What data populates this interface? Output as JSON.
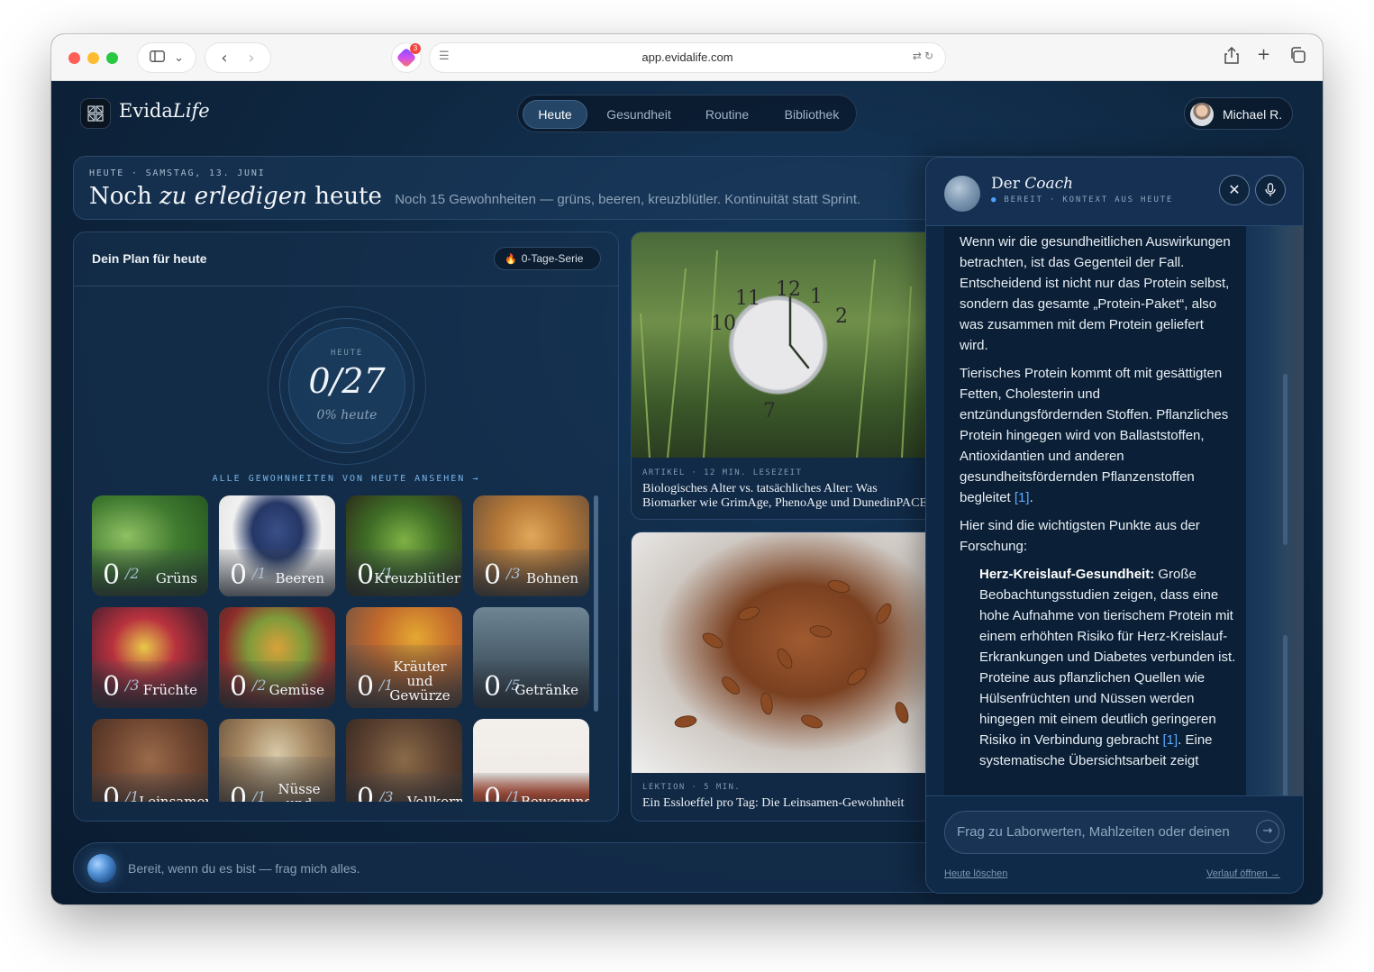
{
  "browser": {
    "url": "app.evidalife.com",
    "extension_badge": "3"
  },
  "app": {
    "brand_main": "Evida",
    "brand_italic": "Life",
    "nav": [
      {
        "label": "Heute",
        "active": true
      },
      {
        "label": "Gesundheit",
        "active": false
      },
      {
        "label": "Routine",
        "active": false
      },
      {
        "label": "Bibliothek",
        "active": false
      }
    ],
    "user_name": "Michael R."
  },
  "header": {
    "eyebrow": "HEUTE · SAMSTAG, 13. JUNI",
    "title_start": "Noch ",
    "title_italic": "zu erledigen",
    "title_end": " heute",
    "subtitle": "Noch 15 Gewohnheiten — grüns, beeren, kreuzblütler. Kontinuität statt Sprint."
  },
  "plan": {
    "title": "Dein Plan für heute",
    "streak": "0-Tage-Serie",
    "ring_label": "HEUTE",
    "ring_value": "0/27",
    "ring_pct": "0% heute",
    "all_habits_link": "ALLE GEWOHNHEITEN VON HEUTE ANSEHEN →",
    "habits": [
      {
        "name": "Grüns",
        "count": "0",
        "goal": "/2"
      },
      {
        "name": "Beeren",
        "count": "0",
        "goal": "/1"
      },
      {
        "name": "Kreuzblütler",
        "count": "0",
        "goal": "/1"
      },
      {
        "name": "Bohnen",
        "count": "0",
        "goal": "/3"
      },
      {
        "name": "Früchte",
        "count": "0",
        "goal": "/3"
      },
      {
        "name": "Gemüse",
        "count": "0",
        "goal": "/2"
      },
      {
        "name": "Kräuter und Gewürze",
        "count": "0",
        "goal": "/1"
      },
      {
        "name": "Getränke",
        "count": "0",
        "goal": "/5"
      },
      {
        "name": "Leinsamen",
        "count": "0",
        "goal": "/1"
      },
      {
        "name": "Nüsse und Samen",
        "count": "0",
        "goal": "/1"
      },
      {
        "name": "Vollkorn",
        "count": "0",
        "goal": "/3"
      },
      {
        "name": "Bewegung",
        "count": "0",
        "goal": "/1"
      }
    ]
  },
  "articles": [
    {
      "meta": "ARTIKEL · 12 MIN. LESEZEIT",
      "title_line1": "Biologisches Alter vs. tatsächliches Alter: Was",
      "title_line2": "Biomarker wie GrimAge, PhenoAge und DunedinPACE"
    },
    {
      "meta": "LEKTION · 5 MIN.",
      "title_line1": "Ein Essloeffel pro Tag: Die Leinsamen-Gewohnheit"
    }
  ],
  "bottom_bar": {
    "text": "Bereit, wenn du es bist — frag mich alles."
  },
  "coach": {
    "title_main": "Der ",
    "title_italic": "Coach",
    "status_dot": "●",
    "status": " BEREIT · KONTEXT AUS HEUTE",
    "paragraphs": [
      "Wenn wir die gesundheitlichen Auswirkungen betrachten, ist das Gegenteil der Fall. Entscheidend ist nicht nur das Protein selbst, sondern das gesamte „Protein-Paket“, also was zusammen mit dem Protein geliefert wird.",
      "Tierisches Protein kommt oft mit gesättigten Fetten, Cholesterin und entzündungsfördernden Stoffen. Pflanzliches Protein hingegen wird von Ballaststoffen, Antioxidantien und anderen gesundheitsfördernden Pflanzenstoffen begleitet",
      "Hier sind die wichtigsten Punkte aus der Forschung:"
    ],
    "citation_1": "[1]",
    "bullet_bold": "Herz-Kreislauf-Gesundheit:",
    "bullet_text": " Große Beobachtungsstudien zeigen, dass eine hohe Aufnahme von tierischem Protein mit einem erhöhten Risiko für Herz-Kreislauf-Erkrankungen und Diabetes verbunden ist. Proteine aus pflanzlichen Quellen wie Hülsenfrüchten und Nüssen werden hingegen mit einem deutlich geringeren Risiko in Verbindung gebracht ",
    "bullet_tail": ". Eine systematische Übersichtsarbeit zeigt",
    "input_placeholder": "Frag zu Laborwerten, Mahlzeiten oder deinen",
    "clear_link": "Heute löschen",
    "history_link": "Verlauf öffnen →"
  },
  "colors": {
    "accent": "#4da3ff",
    "app_background": "#0f2842",
    "streak_flame": "#ff8a3d"
  },
  "icons": {
    "sidebar": "sidebar-icon",
    "back": "chevron-left-icon",
    "forward": "chevron-right-icon",
    "share": "share-icon",
    "new_tab": "plus-icon",
    "tabs": "tabs-icon",
    "close": "close-icon",
    "mic": "mic-icon",
    "send": "arrow-right-icon",
    "flame": "flame-icon"
  }
}
